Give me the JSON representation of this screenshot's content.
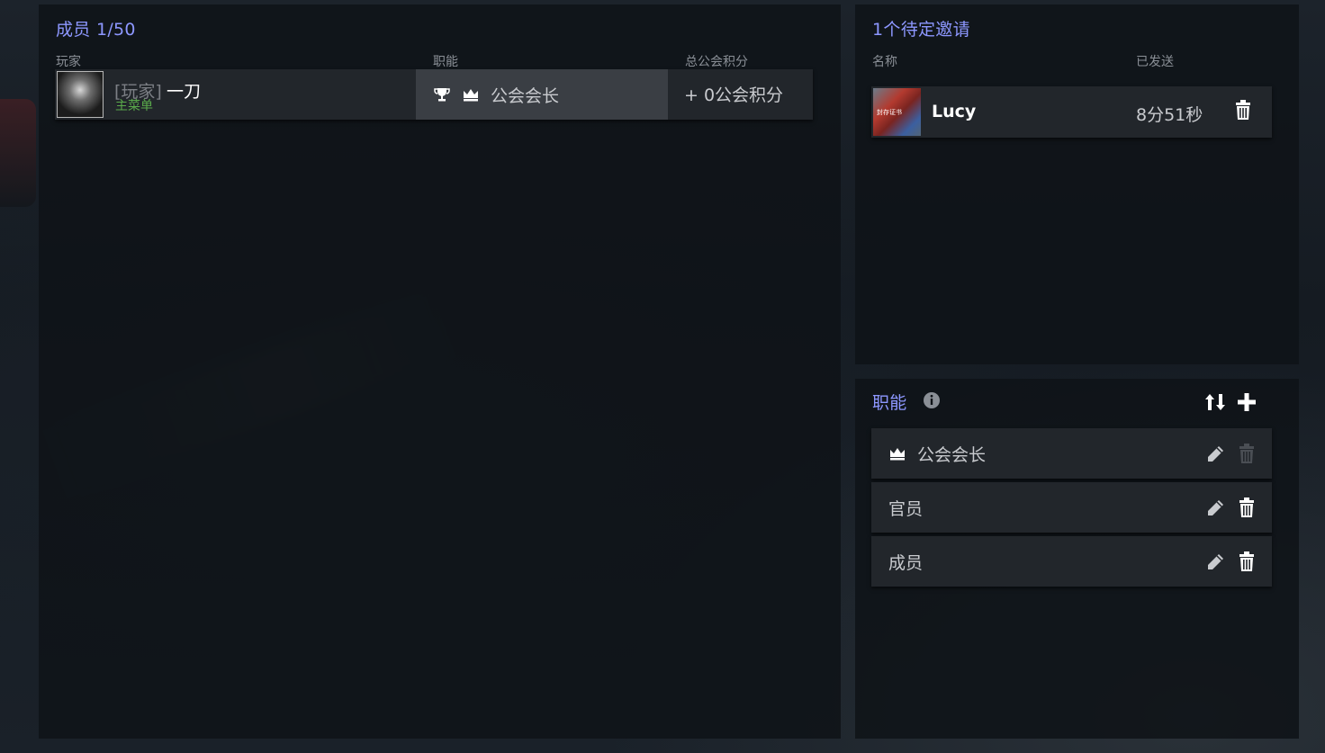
{
  "members": {
    "title": "成员 1/50",
    "columns": {
      "player": "玩家",
      "role": "职能",
      "points": "总公会积分"
    },
    "rows": [
      {
        "prefix": "[玩家]",
        "name": "一刀",
        "status": "主菜单",
        "role_icon_1": "trophy-icon",
        "role_icon_2": "crown-icon",
        "role": "公会会长",
        "points": "+ 0公会积分"
      }
    ]
  },
  "invites": {
    "title": "1个待定邀请",
    "columns": {
      "name": "名称",
      "sent": "已发送"
    },
    "rows": [
      {
        "avatar_text": "封存证书",
        "name": "Lucy",
        "sent": "8分51秒"
      }
    ]
  },
  "roles": {
    "title": "职能",
    "items": [
      {
        "label": "公会会长",
        "icon": "crown-icon",
        "deletable": false
      },
      {
        "label": "官员",
        "deletable": true
      },
      {
        "label": "成员",
        "deletable": true
      }
    ]
  },
  "colors": {
    "accent": "#8d97ff",
    "status_online": "#5aa94b",
    "panel_bg": "#0f1318",
    "row_bg": "#22262b",
    "role_cell_bg": "#3a3e44"
  }
}
